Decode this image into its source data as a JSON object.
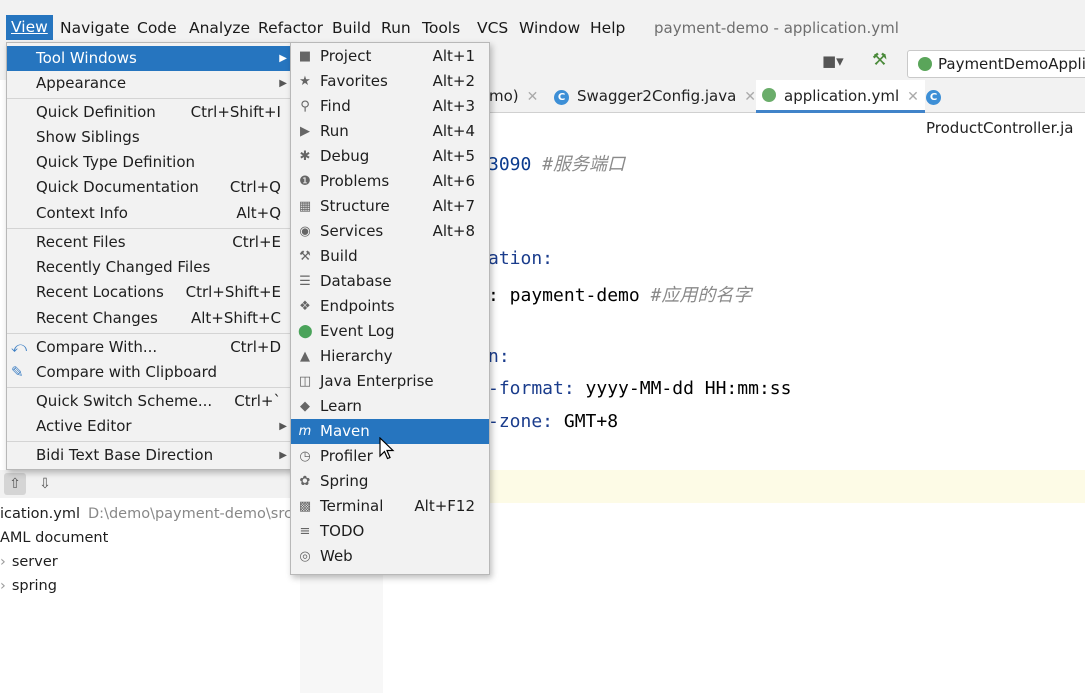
{
  "menubar": {
    "items": [
      "View",
      "Navigate",
      "Code",
      "Analyze",
      "Refactor",
      "Build",
      "Run",
      "Tools",
      "VCS",
      "Window",
      "Help"
    ],
    "title": "payment-demo - application.yml"
  },
  "toolbar": {
    "run_config": "PaymentDemoApplic"
  },
  "tabs": [
    {
      "label": "mo)"
    },
    {
      "label": "Swagger2Config.java"
    },
    {
      "label": "application.yml"
    },
    {
      "label": "ProductController.ja"
    }
  ],
  "editor": {
    "lines": [
      {
        "key": "3090",
        "comment": "#服务端口"
      },
      {
        "key": "ation:"
      },
      {
        "key": ": payment-demo",
        "comment": "#应用的名字"
      },
      {
        "key": "n:"
      },
      {
        "key": "-format:",
        "value": "yyyy-MM-dd HH:mm:ss"
      },
      {
        "key": "-zone:",
        "value": "GMT+8"
      }
    ]
  },
  "project_panel": {
    "file": "ication.yml",
    "path": "D:\\demo\\payment-demo\\src\\",
    "doc": "AML document",
    "nodes": [
      "server",
      "spring"
    ]
  },
  "view_menu": {
    "items": [
      {
        "label": "Tool Windows",
        "submenu": true
      },
      {
        "label": "Appearance",
        "submenu": true
      },
      {
        "label": "Quick Definition",
        "shortcut": "Ctrl+Shift+I"
      },
      {
        "label": "Show Siblings"
      },
      {
        "label": "Quick Type Definition"
      },
      {
        "label": "Quick Documentation",
        "shortcut": "Ctrl+Q"
      },
      {
        "label": "Context Info",
        "shortcut": "Alt+Q"
      },
      {
        "label": "Recent Files",
        "shortcut": "Ctrl+E"
      },
      {
        "label": "Recently Changed Files"
      },
      {
        "label": "Recent Locations",
        "shortcut": "Ctrl+Shift+E"
      },
      {
        "label": "Recent Changes",
        "shortcut": "Alt+Shift+C"
      },
      {
        "label": "Compare With...",
        "shortcut": "Ctrl+D"
      },
      {
        "label": "Compare with Clipboard"
      },
      {
        "label": "Quick Switch Scheme...",
        "shortcut": "Ctrl+`"
      },
      {
        "label": "Active Editor",
        "submenu": true
      },
      {
        "label": "Bidi Text Base Direction",
        "submenu": true
      }
    ]
  },
  "tool_windows": {
    "items": [
      {
        "label": "Project",
        "shortcut": "Alt+1",
        "icon": "folder-icon"
      },
      {
        "label": "Favorites",
        "shortcut": "Alt+2",
        "icon": "star-icon"
      },
      {
        "label": "Find",
        "shortcut": "Alt+3",
        "icon": "search-icon"
      },
      {
        "label": "Run",
        "shortcut": "Alt+4",
        "icon": "run-icon"
      },
      {
        "label": "Debug",
        "shortcut": "Alt+5",
        "icon": "bug-icon"
      },
      {
        "label": "Problems",
        "shortcut": "Alt+6",
        "icon": "problems-icon"
      },
      {
        "label": "Structure",
        "shortcut": "Alt+7",
        "icon": "structure-icon"
      },
      {
        "label": "Services",
        "shortcut": "Alt+8",
        "icon": "services-icon"
      },
      {
        "label": "Build",
        "icon": "hammer-icon"
      },
      {
        "label": "Database",
        "icon": "database-icon"
      },
      {
        "label": "Endpoints",
        "icon": "endpoints-icon"
      },
      {
        "label": "Event Log",
        "icon": "event-log-icon"
      },
      {
        "label": "Hierarchy",
        "icon": "hierarchy-icon"
      },
      {
        "label": "Java Enterprise",
        "icon": "java-enterprise-icon"
      },
      {
        "label": "Learn",
        "icon": "learn-icon"
      },
      {
        "label": "Maven",
        "icon": "maven-icon"
      },
      {
        "label": "Profiler",
        "icon": "profiler-icon"
      },
      {
        "label": "Spring",
        "icon": "spring-icon"
      },
      {
        "label": "Terminal",
        "shortcut": "Alt+F12",
        "icon": "terminal-icon"
      },
      {
        "label": "TODO",
        "icon": "todo-icon"
      },
      {
        "label": "Web",
        "icon": "web-icon"
      }
    ]
  },
  "colors": {
    "selection": "#2675bf",
    "menu_bg": "#f2f2f2"
  }
}
